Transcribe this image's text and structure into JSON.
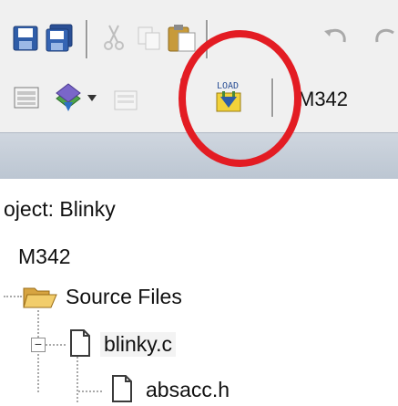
{
  "toolbar": {
    "load_label": "LOAD",
    "target_select": "M342"
  },
  "project": {
    "title": "oject: Blinky",
    "target": "M342",
    "group": "Source Files",
    "files": [
      "blinky.c",
      "absacc.h"
    ]
  },
  "colors": {
    "highlight_circle": "#e31c23",
    "band": "#c6ced8"
  },
  "icons": {
    "row1": [
      "save-icon",
      "save-all-icon",
      "cut-icon",
      "copy-icon",
      "paste-icon",
      "undo-icon",
      "redo-icon"
    ],
    "row2": [
      "build-target-icon",
      "translate-icon",
      "rebuild-icon",
      "download-load-icon"
    ],
    "tree": [
      "folder-icon",
      "file-icon",
      "file-icon"
    ]
  }
}
